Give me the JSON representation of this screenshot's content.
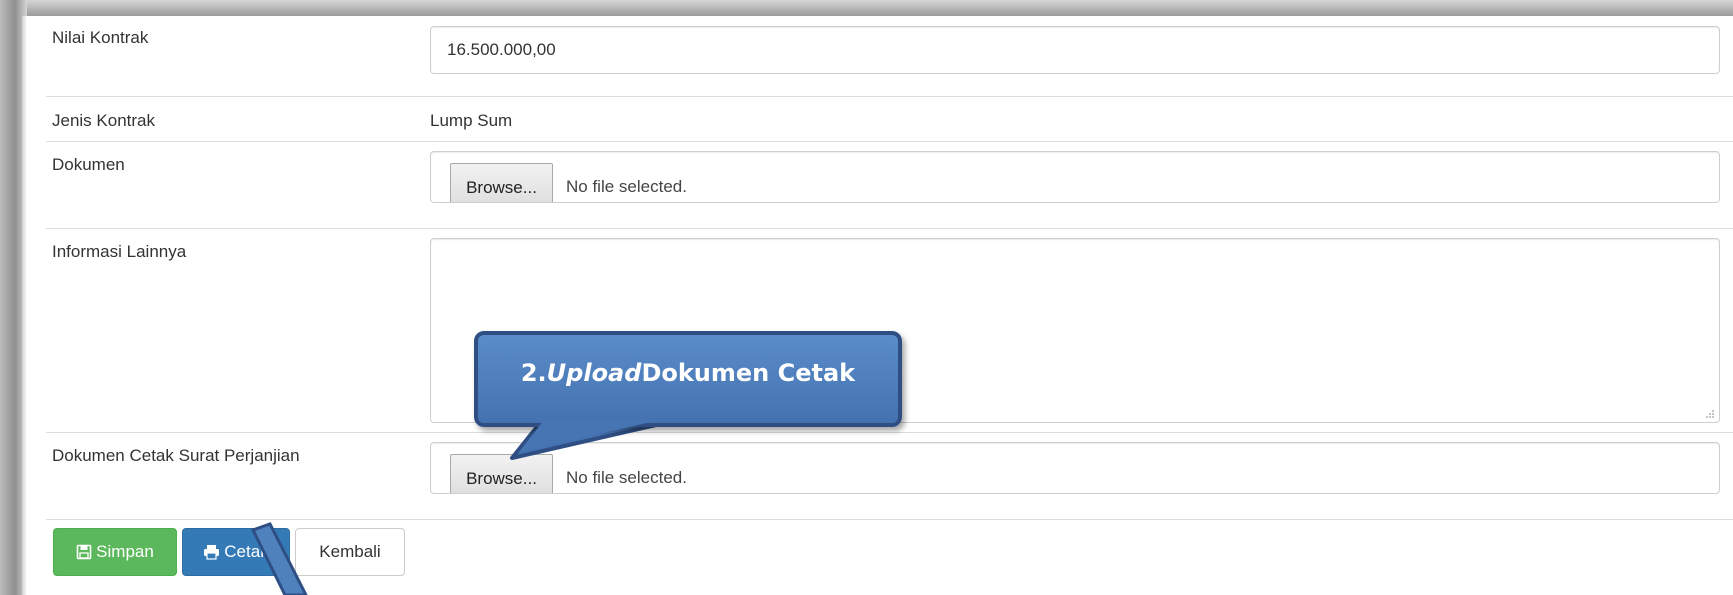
{
  "form": {
    "nilai_kontrak": {
      "label": "Nilai Kontrak",
      "value": "16.500.000,00"
    },
    "jenis_kontrak": {
      "label": "Jenis Kontrak",
      "value": "Lump Sum"
    },
    "dokumen": {
      "label": "Dokumen",
      "browse_label": "Browse...",
      "status": "No file selected."
    },
    "informasi_lainnya": {
      "label": "Informasi Lainnya",
      "value": ""
    },
    "dokumen_cetak": {
      "label": "Dokumen Cetak Surat Perjanjian",
      "browse_label": "Browse...",
      "status": "No file selected."
    }
  },
  "actions": {
    "simpan": {
      "label": "Simpan",
      "icon": "save-icon",
      "color": "#5cb85c"
    },
    "cetak": {
      "label": "Cetak",
      "icon": "print-icon",
      "color": "#337ab7"
    },
    "kembali": {
      "label": "Kembali"
    }
  },
  "annotation": {
    "prefix": "2. ",
    "emphasis": "Upload",
    "suffix": " Dokumen Cetak",
    "color": "#4f81bd"
  }
}
